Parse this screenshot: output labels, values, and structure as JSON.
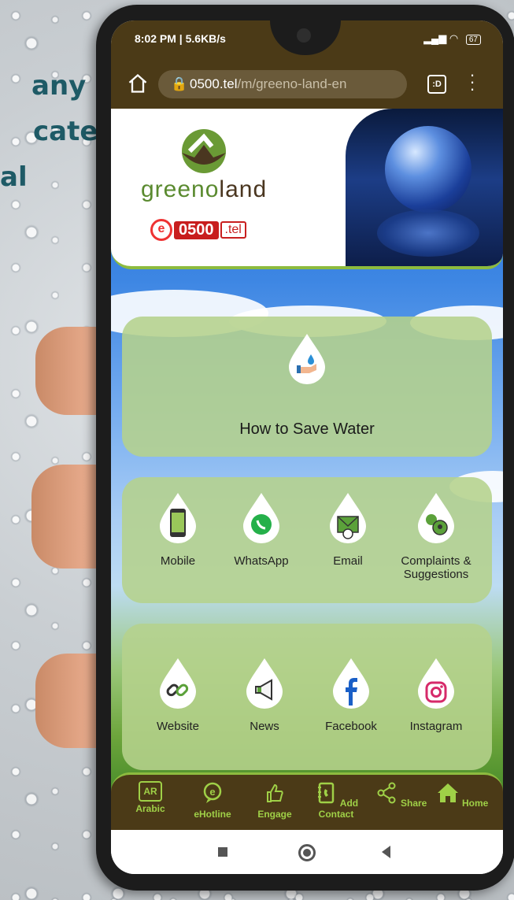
{
  "background_text": [
    "any",
    "cate",
    "al"
  ],
  "status_bar": {
    "time_speed": "8:02 PM | 5.6KB/s",
    "battery": "67"
  },
  "url_bar": {
    "host": "0500.tel",
    "path": "/m/greeno-land-en",
    "tab_count": ":D"
  },
  "header": {
    "brand_part1": "greeno",
    "brand_part2": "land",
    "tel_e": "e",
    "tel_number": "0500",
    "tel_domain": ".tel"
  },
  "main_card": {
    "label": "How to Save Water"
  },
  "contact_row": [
    {
      "label": "Mobile",
      "icon": "mobile-phone-icon"
    },
    {
      "label": "WhatsApp",
      "icon": "whatsapp-icon"
    },
    {
      "label": "Email",
      "icon": "email-icon"
    },
    {
      "label": "Complaints & Suggestions",
      "icon": "complaints-icon"
    }
  ],
  "social_row": [
    {
      "label": "Website",
      "icon": "link-icon"
    },
    {
      "label": "News",
      "icon": "megaphone-icon"
    },
    {
      "label": "Facebook",
      "icon": "facebook-icon"
    },
    {
      "label": "Instagram",
      "icon": "instagram-icon"
    }
  ],
  "footer": [
    {
      "label": "Arabic",
      "icon": "ar-icon",
      "icon_text": "AR"
    },
    {
      "label": "eHotline",
      "icon": "ehotline-icon"
    },
    {
      "label": "Engage",
      "icon": "thumbs-up-icon"
    },
    {
      "label": "Add Contact",
      "icon": "contact-book-icon"
    },
    {
      "label": "Share",
      "icon": "share-icon"
    },
    {
      "label": "Home",
      "icon": "home-icon"
    }
  ],
  "colors": {
    "bar_brown": "#4b3a17",
    "accent_green": "#9fd047",
    "card_green": "#b5d28c",
    "text_teal": "#1e5a66"
  }
}
